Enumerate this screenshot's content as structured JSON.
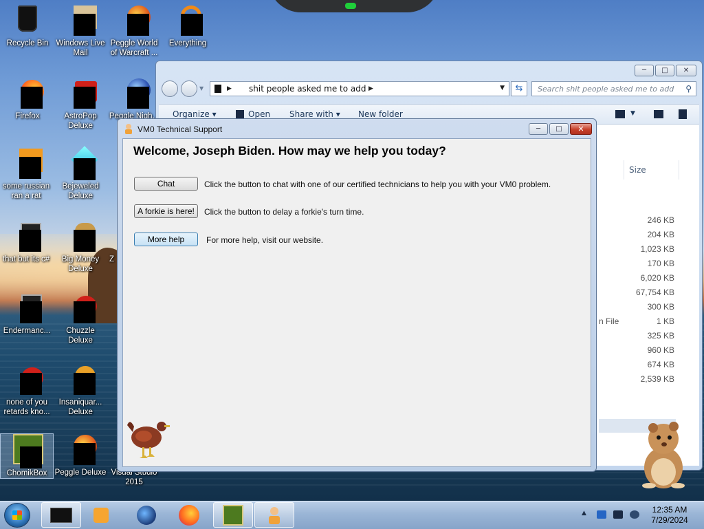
{
  "desktop": {
    "icons": [
      {
        "label": "Recycle Bin"
      },
      {
        "label": "Windows Live Mail"
      },
      {
        "label": "Peggle World of Warcraft ..."
      },
      {
        "label": "Everything"
      },
      {
        "label": "Firefox"
      },
      {
        "label": "AstroPop Deluxe"
      },
      {
        "label": "Peggle Nigh..."
      },
      {
        "label": "some russian ran a rat"
      },
      {
        "label": "Bejeweled Deluxe"
      },
      {
        "label": "that but its c#"
      },
      {
        "label": "Big Money Deluxe"
      },
      {
        "label": "Z"
      },
      {
        "label": "Endermanc..."
      },
      {
        "label": "Chuzzle Deluxe"
      },
      {
        "label": "none of you retards kno..."
      },
      {
        "label": "Insaniquar... Deluxe"
      },
      {
        "label": "ChomikBox"
      },
      {
        "label": "Peggle Deluxe"
      },
      {
        "label": "Visual Studio 2015"
      }
    ]
  },
  "explorer": {
    "address_path": "shit people asked me to add",
    "search_placeholder": "Search shit people asked me to add",
    "commands": {
      "organize": "Organize",
      "open": "Open",
      "share_with": "Share with",
      "new_folder": "New folder"
    },
    "column_size": "Size",
    "type_fragment": "n File",
    "sizes": [
      "246 KB",
      "204 KB",
      "1,023 KB",
      "170 KB",
      "6,020 KB",
      "67,754 KB",
      "300 KB",
      "1 KB",
      "325 KB",
      "960 KB",
      "674 KB",
      "2,539 KB"
    ],
    "selected_row_index": 10
  },
  "dialog": {
    "title": "VM0 Technical Support",
    "welcome": "Welcome, Joseph Biden. How may we help you today?",
    "chat_button": "Chat",
    "chat_desc": "Click the button to chat with one of our certified technicians to help you with your VM0 problem.",
    "forkie_button": "A forkie is here!",
    "forkie_desc": "Click the button to delay a forkie's turn time.",
    "more_help_button": "More help",
    "more_help_desc": "For more help, visit our website."
  },
  "taskbar": {
    "time": "12:35 AM",
    "date": "7/29/2024"
  },
  "colors": {
    "close_red": "#c7402b",
    "window_frame": "#b9cde6",
    "taskbar": "#9ab5d6"
  }
}
